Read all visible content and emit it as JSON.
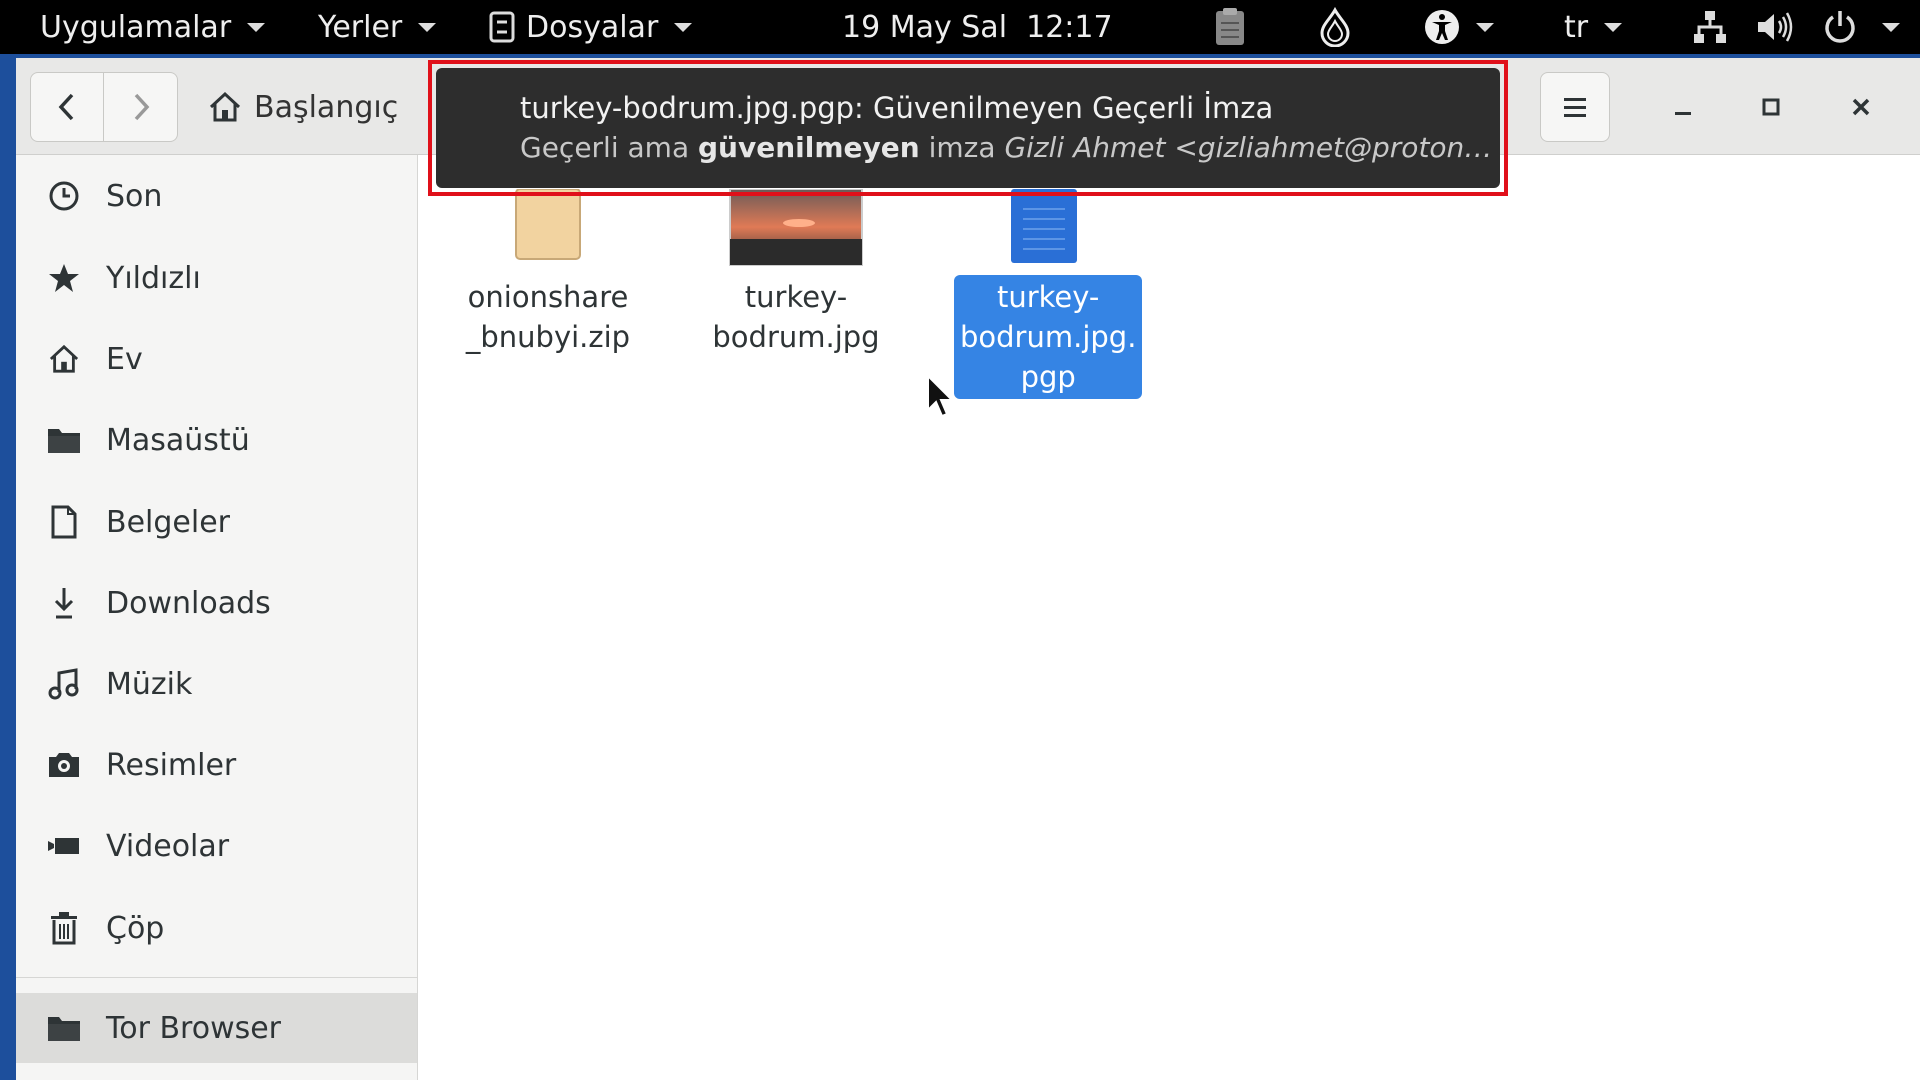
{
  "topbar": {
    "apps_label": "Uygulamalar",
    "places_label": "Yerler",
    "files_label": "Dosyalar",
    "clock": "19 May Sal  12:17",
    "lang": "tr"
  },
  "header": {
    "breadcrumb_home": "Başlangıç"
  },
  "sidebar": {
    "items": [
      {
        "label": "Son",
        "icon": "clock-icon"
      },
      {
        "label": "Yıldızlı",
        "icon": "star-icon"
      },
      {
        "label": "Ev",
        "icon": "home-icon"
      },
      {
        "label": "Masaüstü",
        "icon": "folder-icon"
      },
      {
        "label": "Belgeler",
        "icon": "document-icon"
      },
      {
        "label": "Downloads",
        "icon": "download-icon"
      },
      {
        "label": "Müzik",
        "icon": "music-icon"
      },
      {
        "label": "Resimler",
        "icon": "camera-icon"
      },
      {
        "label": "Videolar",
        "icon": "video-icon"
      },
      {
        "label": "Çöp",
        "icon": "trash-icon"
      }
    ],
    "bottom_item": {
      "label": "Tor Browser",
      "icon": "folder-icon"
    }
  },
  "files": [
    {
      "name": "onionshare\n_bnubyi.zip",
      "line1": "onionshare",
      "line2": "_bnubyi.zip",
      "type": "archive"
    },
    {
      "name": "turkey-bodrum.jpg",
      "line1": "turkey-",
      "line2": "bodrum.jpg",
      "type": "image"
    },
    {
      "name": "turkey-bodrum.jpg.pgp",
      "line1": "turkey-",
      "line2": "bodrum.jpg.",
      "line3": "pgp",
      "type": "document",
      "selected": true
    }
  ],
  "notification": {
    "title": "turkey-bodrum.jpg.pgp: Güvenilmeyen Geçerli İmza",
    "body_prefix": "Geçerli ama",
    "body_bold": "güvenilmeyen",
    "body_mid": "imza",
    "body_italic": "Gizli Ahmet <gizliahmet@proton…"
  },
  "colors": {
    "selection": "#3584e4",
    "highlight_frame": "#e0101a",
    "topbar": "#000000"
  }
}
